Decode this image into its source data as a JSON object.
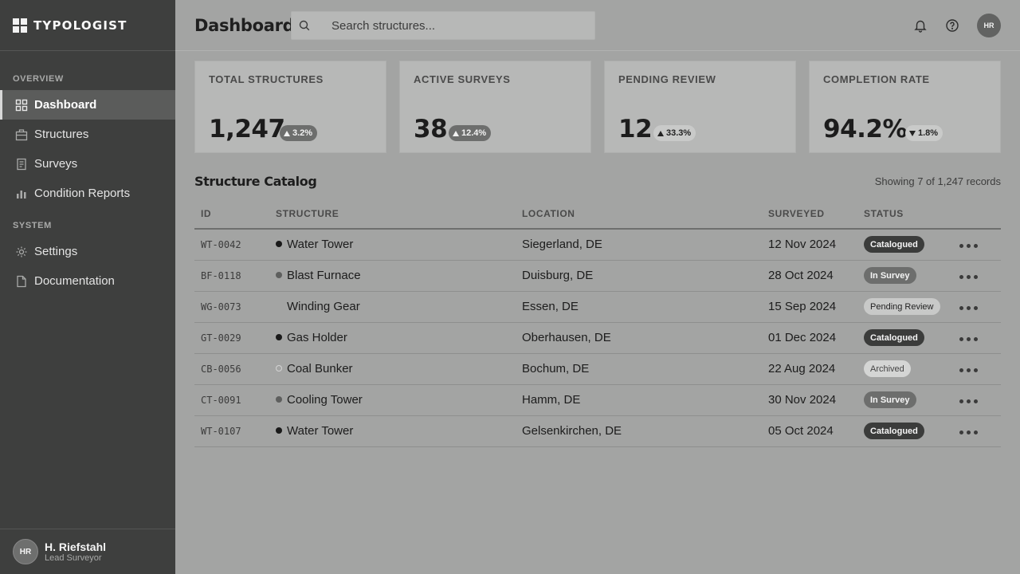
{
  "app": {
    "name": "TYPOLOGIST",
    "page_title": "Dashboard"
  },
  "sidebar": {
    "sections": [
      {
        "label": "OVERVIEW",
        "items": [
          {
            "label": "Dashboard",
            "icon": "grid-icon",
            "active": true
          },
          {
            "label": "Structures",
            "icon": "briefcase-icon",
            "active": false
          },
          {
            "label": "Surveys",
            "icon": "document-list-icon",
            "active": false
          },
          {
            "label": "Condition Reports",
            "icon": "bar-chart-icon",
            "active": false
          }
        ]
      },
      {
        "label": "SYSTEM",
        "items": [
          {
            "label": "Settings",
            "icon": "gear-icon",
            "active": false
          },
          {
            "label": "Documentation",
            "icon": "file-icon",
            "active": false
          }
        ]
      }
    ],
    "user": {
      "initials": "HR",
      "name": "H. Riefstahl",
      "role": "Lead Surveyor"
    }
  },
  "header": {
    "search_placeholder": "Search structures...",
    "avatar_initials": "HR"
  },
  "stats": [
    {
      "label": "TOTAL STRUCTURES",
      "value": "1,247",
      "delta": "3.2%",
      "trend": "up",
      "badge_style": "dark"
    },
    {
      "label": "ACTIVE SURVEYS",
      "value": "38",
      "delta": "12.4%",
      "trend": "up",
      "badge_style": "dark"
    },
    {
      "label": "PENDING REVIEW",
      "value": "12",
      "delta": "33.3%",
      "trend": "up",
      "badge_style": "light"
    },
    {
      "label": "COMPLETION RATE",
      "value": "94.2%",
      "delta": "1.8%",
      "trend": "down",
      "badge_style": "light"
    }
  ],
  "catalog": {
    "title": "Structure Catalog",
    "count_text": "Showing 7 of 1,247 records",
    "columns": [
      "ID",
      "STRUCTURE",
      "LOCATION",
      "SURVEYED",
      "STATUS"
    ],
    "rows": [
      {
        "id": "WT-0042",
        "structure": "Water Tower",
        "dot": "black",
        "location": "Siegerland, DE",
        "surveyed": "12 Nov 2024",
        "status": "Catalogued"
      },
      {
        "id": "BF-0118",
        "structure": "Blast Furnace",
        "dot": "grey",
        "location": "Duisburg, DE",
        "surveyed": "28 Oct 2024",
        "status": "In Survey"
      },
      {
        "id": "WG-0073",
        "structure": "Winding Gear",
        "dot": "none",
        "location": "Essen, DE",
        "surveyed": "15 Sep 2024",
        "status": "Pending Review"
      },
      {
        "id": "GT-0029",
        "structure": "Gas Holder",
        "dot": "black",
        "location": "Oberhausen, DE",
        "surveyed": "01 Dec 2024",
        "status": "Catalogued"
      },
      {
        "id": "CB-0056",
        "structure": "Coal Bunker",
        "dot": "outline",
        "location": "Bochum, DE",
        "surveyed": "22 Aug 2024",
        "status": "Archived"
      },
      {
        "id": "CT-0091",
        "structure": "Cooling Tower",
        "dot": "grey",
        "location": "Hamm, DE",
        "surveyed": "30 Nov 2024",
        "status": "In Survey"
      },
      {
        "id": "WT-0107",
        "structure": "Water Tower",
        "dot": "black",
        "location": "Gelsenkirchen, DE",
        "surveyed": "05 Oct 2024",
        "status": "Catalogued"
      }
    ]
  }
}
